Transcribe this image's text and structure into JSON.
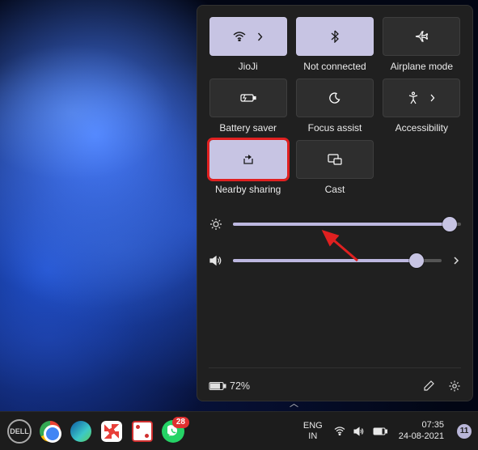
{
  "quick_settings": {
    "tiles": [
      {
        "id": "wifi",
        "label": "JioJi",
        "active": true,
        "has_arrow": true
      },
      {
        "id": "bluetooth",
        "label": "Not connected",
        "active": true,
        "has_arrow": false
      },
      {
        "id": "airplane",
        "label": "Airplane mode",
        "active": false,
        "has_arrow": false
      },
      {
        "id": "battery-saver",
        "label": "Battery saver",
        "active": false,
        "has_arrow": false
      },
      {
        "id": "focus-assist",
        "label": "Focus assist",
        "active": false,
        "has_arrow": false
      },
      {
        "id": "accessibility",
        "label": "Accessibility",
        "active": false,
        "has_arrow": true
      },
      {
        "id": "nearby-sharing",
        "label": "Nearby sharing",
        "active": true,
        "highlighted": true
      },
      {
        "id": "cast",
        "label": "Cast",
        "active": false,
        "has_arrow": false
      }
    ],
    "brightness_percent": 95,
    "volume_percent": 88,
    "battery_text": "72%"
  },
  "taskbar": {
    "whatsapp_badge": "28",
    "language": {
      "lang": "ENG",
      "region": "IN"
    },
    "clock": {
      "time": "07:35",
      "date": "24-08-2021"
    },
    "notification_count": "11"
  }
}
